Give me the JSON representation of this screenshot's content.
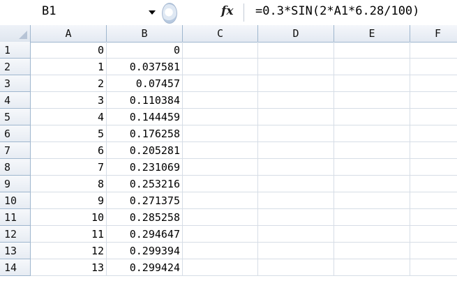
{
  "formula_bar": {
    "name_box": "B1",
    "fx_label": "fx",
    "formula": "=0.3*SIN(2*A1*6.28/100)"
  },
  "columns": [
    "A",
    "B",
    "C",
    "D",
    "E",
    "F"
  ],
  "rows": [
    {
      "num": "1",
      "a": "0",
      "b": "0"
    },
    {
      "num": "2",
      "a": "1",
      "b": "0.037581"
    },
    {
      "num": "3",
      "a": "2",
      "b": "0.07457"
    },
    {
      "num": "4",
      "a": "3",
      "b": "0.110384"
    },
    {
      "num": "5",
      "a": "4",
      "b": "0.144459"
    },
    {
      "num": "6",
      "a": "5",
      "b": "0.176258"
    },
    {
      "num": "7",
      "a": "6",
      "b": "0.205281"
    },
    {
      "num": "8",
      "a": "7",
      "b": "0.231069"
    },
    {
      "num": "9",
      "a": "8",
      "b": "0.253216"
    },
    {
      "num": "10",
      "a": "9",
      "b": "0.271375"
    },
    {
      "num": "11",
      "a": "10",
      "b": "0.285258"
    },
    {
      "num": "12",
      "a": "11",
      "b": "0.294647"
    },
    {
      "num": "13",
      "a": "12",
      "b": "0.299394"
    },
    {
      "num": "14",
      "a": "13",
      "b": "0.299424"
    }
  ]
}
